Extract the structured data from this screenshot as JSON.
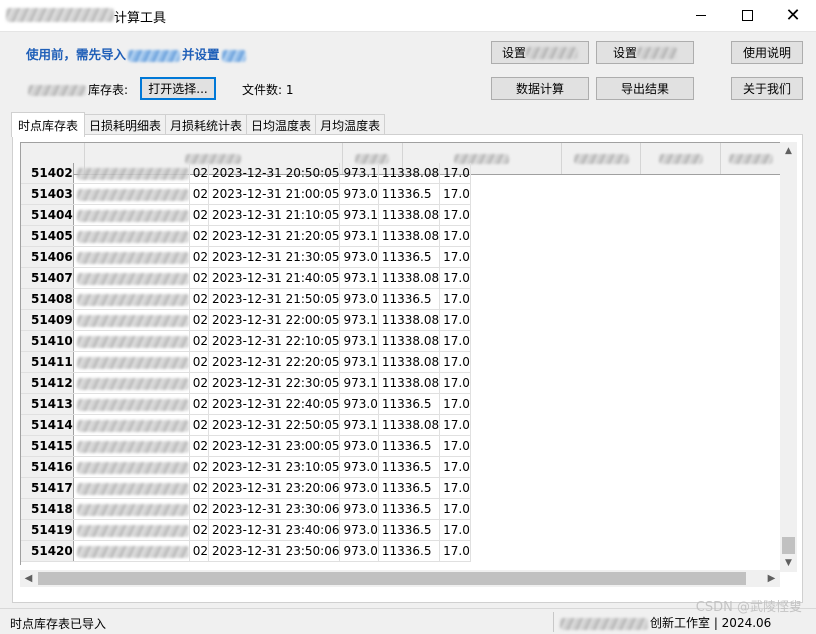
{
  "window": {
    "title": "计算工具",
    "controls": {
      "minimize_icon": "minimize-icon",
      "maximize_icon": "maximize-icon",
      "close_icon": "close-icon"
    }
  },
  "top": {
    "notice_prefix": "使用前，需先导入",
    "notice_suffix": "并设置",
    "stock_label": "库存表:",
    "open_button": "打开选择...",
    "file_count_label": "文件数:",
    "file_count": "1",
    "buttons": {
      "settings_a": "设置",
      "settings_b": "设置",
      "help": "使用说明",
      "calculate": "数据计算",
      "export": "导出结果",
      "about": "关于我们"
    }
  },
  "tabs": [
    "时点库存表",
    "日损耗明细表",
    "月损耗统计表",
    "日均温度表",
    "月均温度表"
  ],
  "grid": {
    "rows": [
      {
        "id": "51402",
        "c2": "02",
        "time": "2023-12-31 20:50:05",
        "v1": "973.1",
        "v2": "11338.08",
        "v3": "17.0"
      },
      {
        "id": "51403",
        "c2": "02",
        "time": "2023-12-31 21:00:05",
        "v1": "973.0",
        "v2": "11336.5",
        "v3": "17.0"
      },
      {
        "id": "51404",
        "c2": "02",
        "time": "2023-12-31 21:10:05",
        "v1": "973.1",
        "v2": "11338.08",
        "v3": "17.0"
      },
      {
        "id": "51405",
        "c2": "02",
        "time": "2023-12-31 21:20:05",
        "v1": "973.1",
        "v2": "11338.08",
        "v3": "17.0"
      },
      {
        "id": "51406",
        "c2": "02",
        "time": "2023-12-31 21:30:05",
        "v1": "973.0",
        "v2": "11336.5",
        "v3": "17.0"
      },
      {
        "id": "51407",
        "c2": "02",
        "time": "2023-12-31 21:40:05",
        "v1": "973.1",
        "v2": "11338.08",
        "v3": "17.0"
      },
      {
        "id": "51408",
        "c2": "02",
        "time": "2023-12-31 21:50:05",
        "v1": "973.0",
        "v2": "11336.5",
        "v3": "17.0"
      },
      {
        "id": "51409",
        "c2": "02",
        "time": "2023-12-31 22:00:05",
        "v1": "973.1",
        "v2": "11338.08",
        "v3": "17.0"
      },
      {
        "id": "51410",
        "c2": "02",
        "time": "2023-12-31 22:10:05",
        "v1": "973.1",
        "v2": "11338.08",
        "v3": "17.0"
      },
      {
        "id": "51411",
        "c2": "02",
        "time": "2023-12-31 22:20:05",
        "v1": "973.1",
        "v2": "11338.08",
        "v3": "17.0"
      },
      {
        "id": "51412",
        "c2": "02",
        "time": "2023-12-31 22:30:05",
        "v1": "973.1",
        "v2": "11338.08",
        "v3": "17.0"
      },
      {
        "id": "51413",
        "c2": "02",
        "time": "2023-12-31 22:40:05",
        "v1": "973.0",
        "v2": "11336.5",
        "v3": "17.0"
      },
      {
        "id": "51414",
        "c2": "02",
        "time": "2023-12-31 22:50:05",
        "v1": "973.1",
        "v2": "11338.08",
        "v3": "17.0"
      },
      {
        "id": "51415",
        "c2": "02",
        "time": "2023-12-31 23:00:05",
        "v1": "973.0",
        "v2": "11336.5",
        "v3": "17.0"
      },
      {
        "id": "51416",
        "c2": "02",
        "time": "2023-12-31 23:10:05",
        "v1": "973.0",
        "v2": "11336.5",
        "v3": "17.0"
      },
      {
        "id": "51417",
        "c2": "02",
        "time": "2023-12-31 23:20:06",
        "v1": "973.0",
        "v2": "11336.5",
        "v3": "17.0"
      },
      {
        "id": "51418",
        "c2": "02",
        "time": "2023-12-31 23:30:06",
        "v1": "973.0",
        "v2": "11336.5",
        "v3": "17.0"
      },
      {
        "id": "51419",
        "c2": "02",
        "time": "2023-12-31 23:40:06",
        "v1": "973.0",
        "v2": "11336.5",
        "v3": "17.0"
      },
      {
        "id": "51420",
        "c2": "02",
        "time": "2023-12-31 23:50:06",
        "v1": "973.0",
        "v2": "11336.5",
        "v3": "17.0"
      }
    ]
  },
  "status": {
    "left": "时点库存表已导入",
    "right": "创新工作室 | 2024.06"
  },
  "watermark": "CSDN @武陵悭叟",
  "colors": {
    "notice_blue": "#1f5fb8",
    "focus_blue": "#0078d7"
  }
}
